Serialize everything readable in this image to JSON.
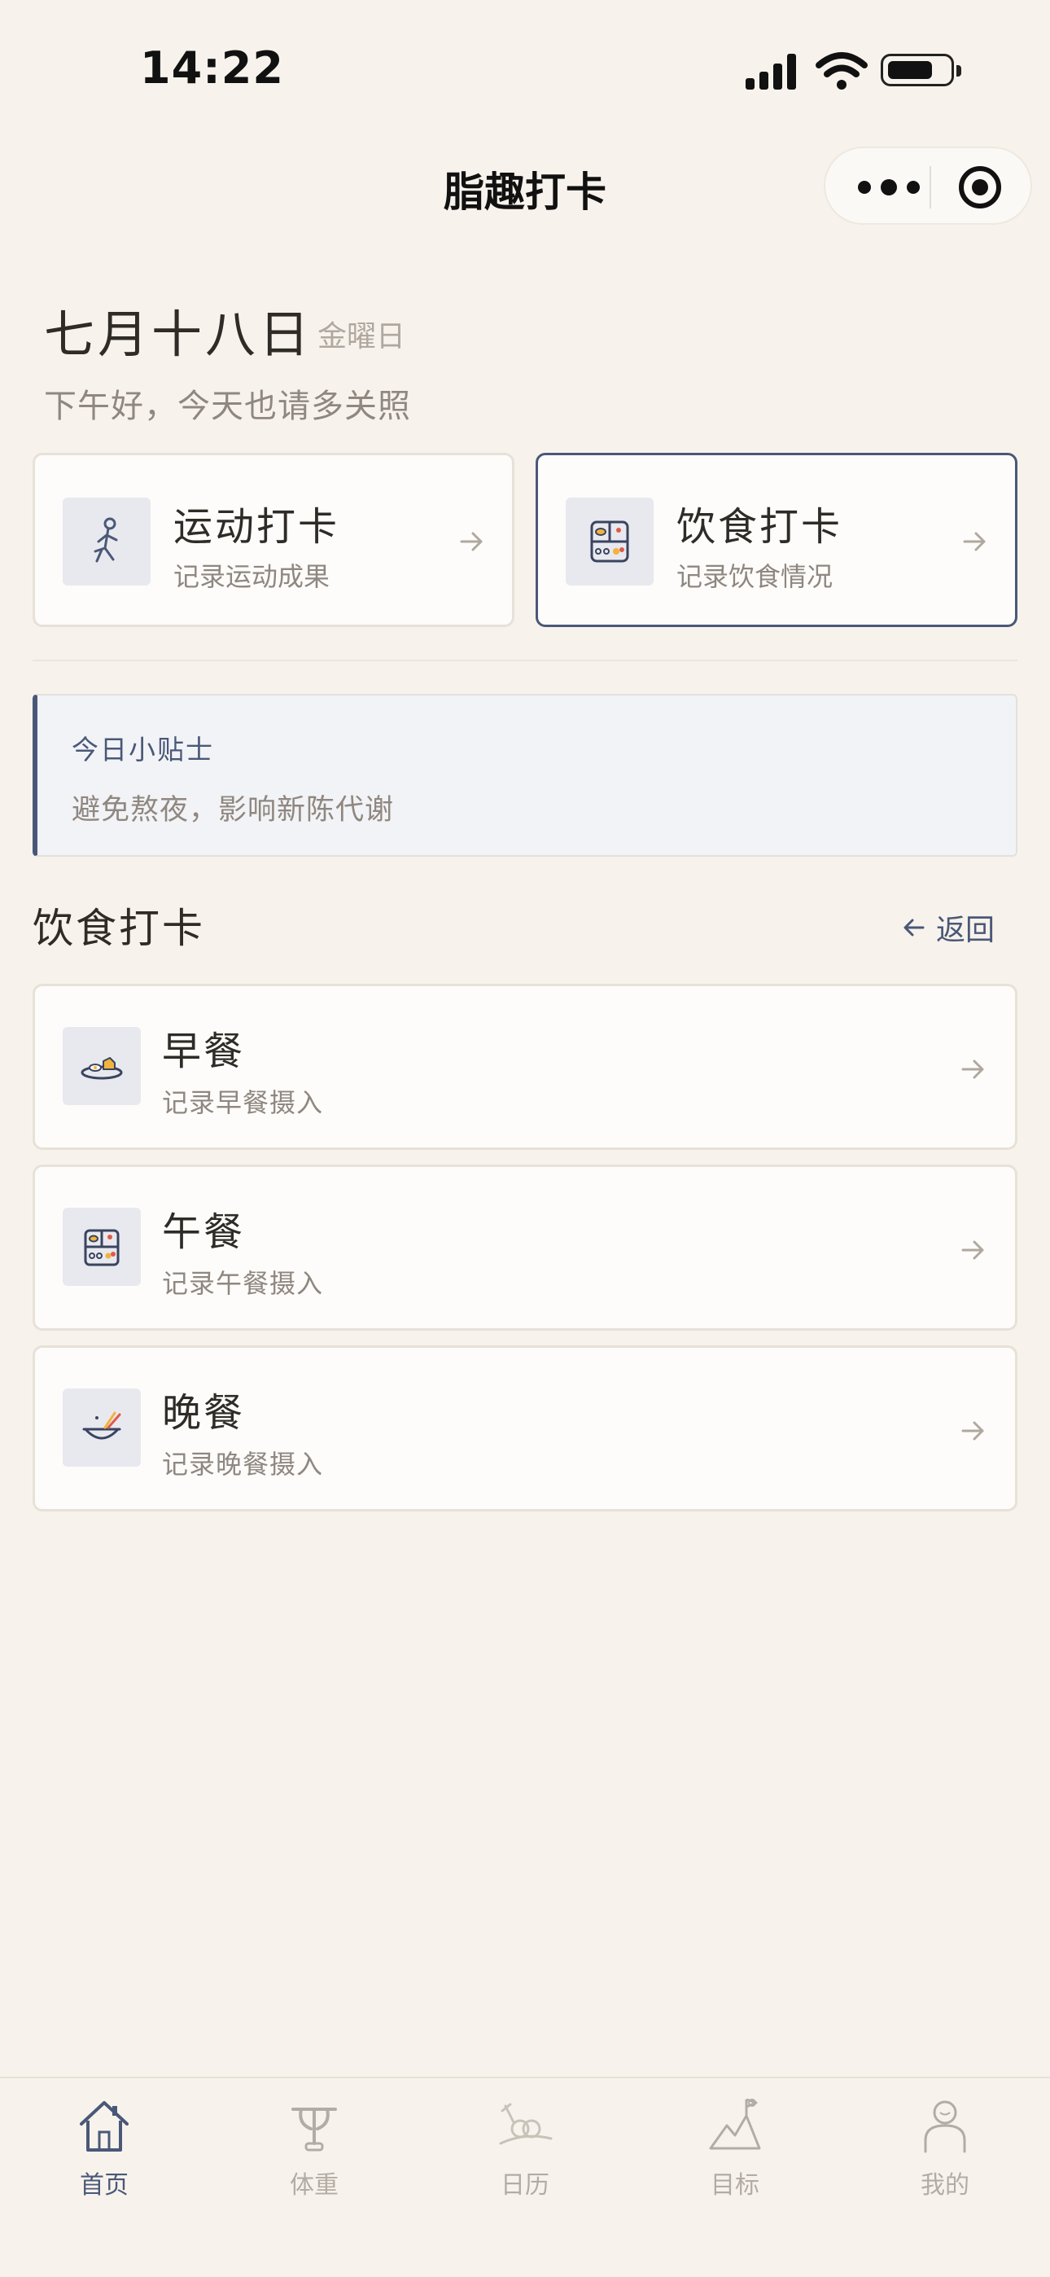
{
  "status_bar": {
    "time": "14:22"
  },
  "nav": {
    "title": "脂趣打卡"
  },
  "header": {
    "date": "七月十八日",
    "weekday": "金曜日",
    "greeting": "下午好，今天也请多关照"
  },
  "quick_cards": [
    {
      "title": "运动打卡",
      "subtitle": "记录运动成果",
      "icon": "running-person-icon"
    },
    {
      "title": "饮食打卡",
      "subtitle": "记录饮食情况",
      "icon": "bento-box-icon"
    }
  ],
  "tip": {
    "title": "今日小贴士",
    "text": "避免熬夜，影响新陈代谢"
  },
  "section": {
    "title": "饮食打卡",
    "back_label": "返回"
  },
  "meals": [
    {
      "title": "早餐",
      "subtitle": "记录早餐摄入",
      "icon": "breakfast-plate-icon"
    },
    {
      "title": "午餐",
      "subtitle": "记录午餐摄入",
      "icon": "bento-box-icon"
    },
    {
      "title": "晚餐",
      "subtitle": "记录晚餐摄入",
      "icon": "noodle-bowl-icon"
    }
  ],
  "tabs": [
    {
      "label": "首页",
      "icon": "home-icon",
      "active": true
    },
    {
      "label": "体重",
      "icon": "scale-icon",
      "active": false
    },
    {
      "label": "日历",
      "icon": "calendar-icon",
      "active": false
    },
    {
      "label": "目标",
      "icon": "mountain-flag-icon",
      "active": false
    },
    {
      "label": "我的",
      "icon": "profile-icon",
      "active": false
    }
  ],
  "colors": {
    "background": "#f7f3ec",
    "accent": "#4a5878",
    "card": "#fdfcfa",
    "muted_text": "#8f8780"
  }
}
